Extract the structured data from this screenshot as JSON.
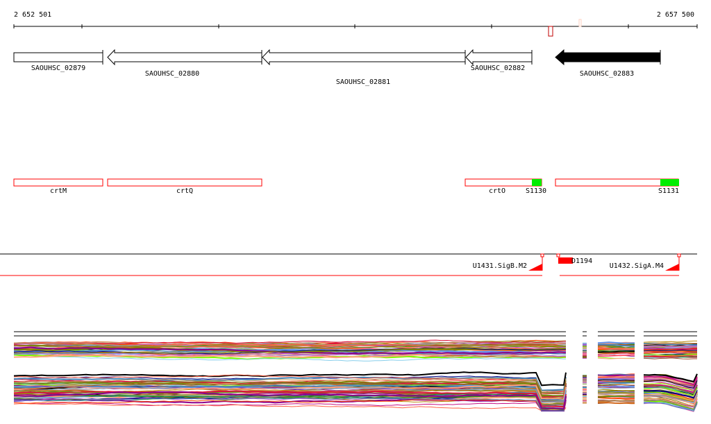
{
  "ruler": {
    "start_label": "2 652 501",
    "end_label": "2 657 500"
  },
  "genes": [
    {
      "id": "SAOUHSC_02879",
      "strand": "+",
      "filled": false
    },
    {
      "id": "SAOUHSC_02880",
      "strand": "-",
      "filled": false
    },
    {
      "id": "SAOUHSC_02881",
      "strand": "-",
      "filled": false
    },
    {
      "id": "SAOUHSC_02882",
      "strand": "-",
      "filled": false
    },
    {
      "id": "SAOUHSC_02883",
      "strand": "-",
      "filled": true
    }
  ],
  "operons": [
    {
      "name": "crtM",
      "sigma": ""
    },
    {
      "name": "crtQ",
      "sigma": ""
    },
    {
      "name": "crtO",
      "sigma": "S1130"
    },
    {
      "name": "",
      "sigma": "S1131"
    }
  ],
  "promoters": [
    {
      "label": "U1431.SigB.M2"
    },
    {
      "label": "U1432.SigA.M4"
    }
  ],
  "deletion": {
    "label": "D1194"
  },
  "colors": {
    "operon": "#ff0000",
    "sigma_site": "#00ee00",
    "feature_red": "#ff0000",
    "expression_palette": [
      "#6b8e23",
      "#ff6347",
      "#9370db",
      "#87ceeb",
      "#8b008b",
      "#c0a060",
      "#ff4500",
      "#7cfc00",
      "#000080",
      "#cd853f",
      "#d2691e",
      "#ba55d3",
      "#b8860b",
      "#4682b4",
      "#808000",
      "#dc143c",
      "#c71585",
      "#a0522d",
      "#6495ed",
      "#228b22",
      "#000000",
      "#bc8f8f",
      "#ffa07a",
      "#ff69b4"
    ]
  }
}
